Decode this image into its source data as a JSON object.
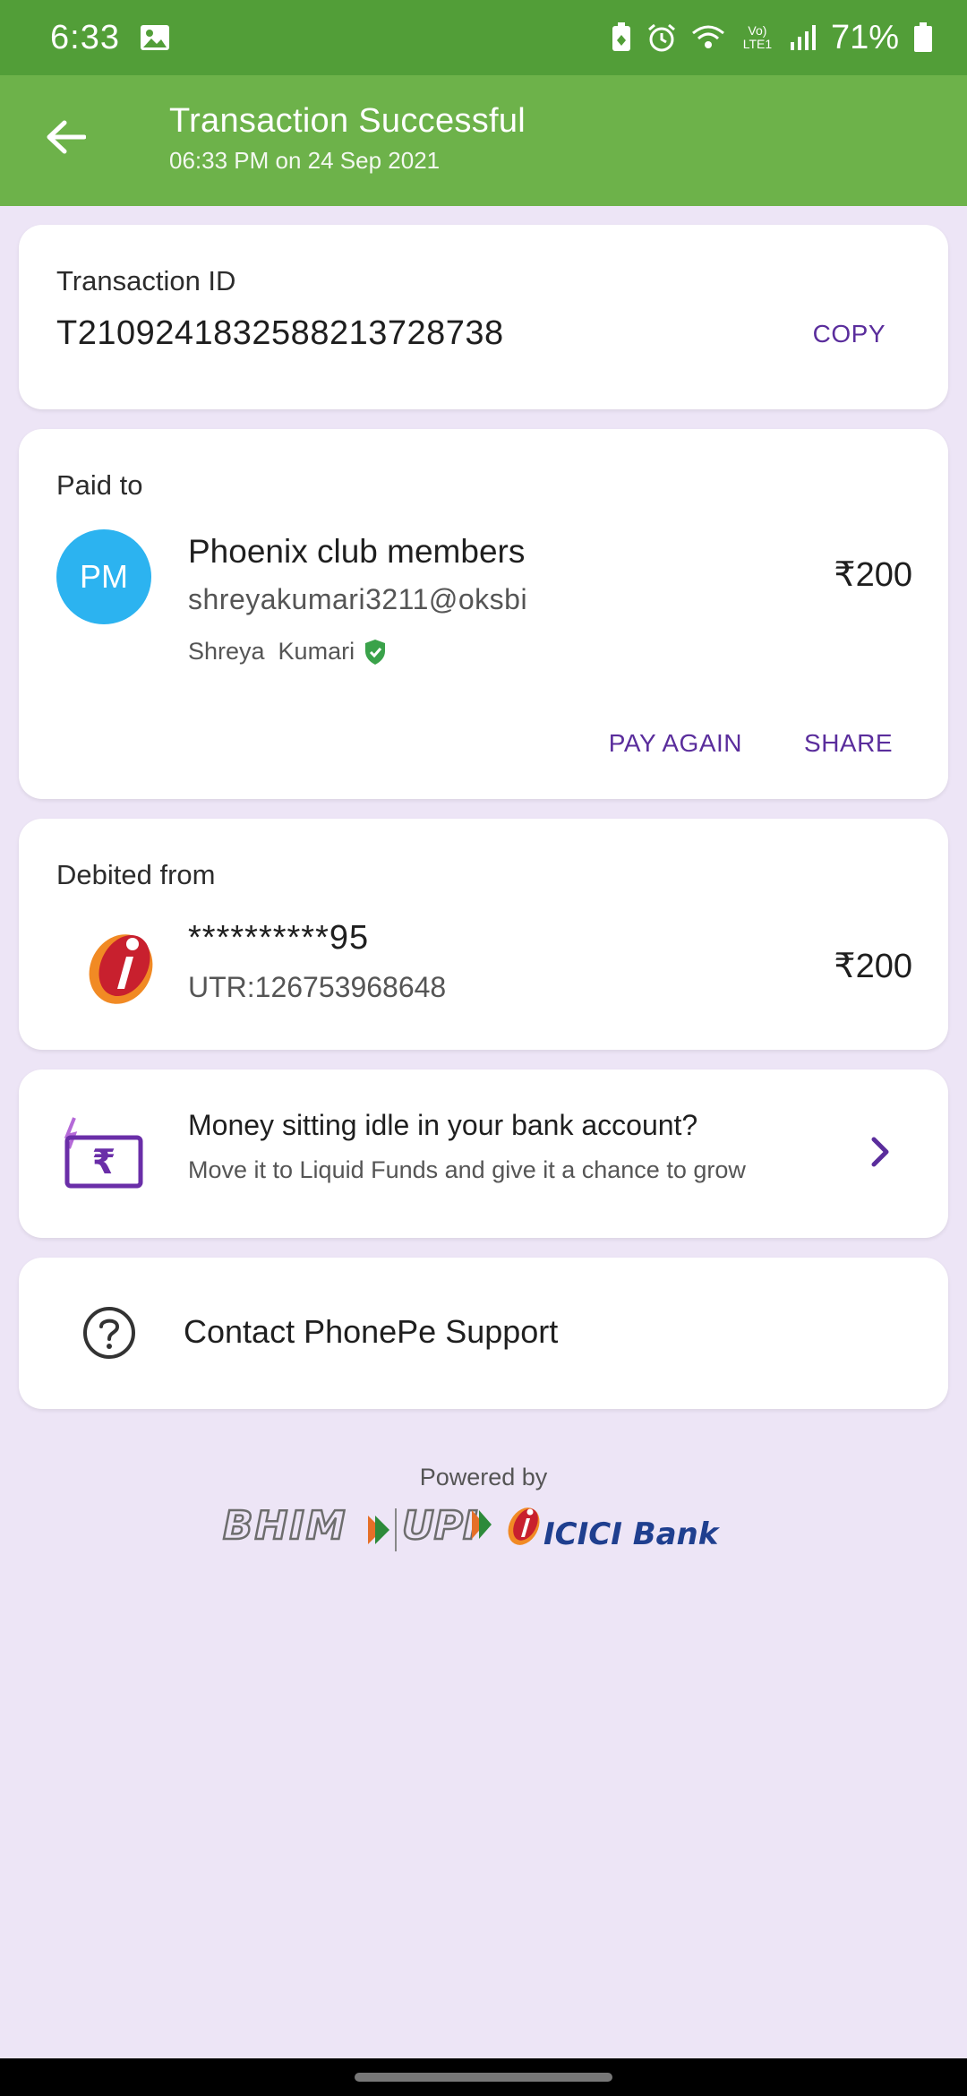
{
  "status_bar": {
    "time": "6:33",
    "battery_pct": "71%",
    "network_label": "Vo) LTE1",
    "icons": [
      "gallery-icon",
      "battery-saver-icon",
      "alarm-icon",
      "wifi-icon",
      "volte-icon",
      "signal-icon",
      "battery-icon"
    ]
  },
  "header": {
    "title": "Transaction Successful",
    "subtitle": "06:33 PM on 24 Sep 2021",
    "back_icon": "arrow-left-icon",
    "color": "#6db24a"
  },
  "transaction": {
    "label": "Transaction ID",
    "id": "T2109241832588213728738",
    "copy_label": "COPY"
  },
  "paid_to": {
    "label": "Paid to",
    "avatar_initials": "PM",
    "avatar_color": "#2cb3f0",
    "name": "Phoenix club members",
    "upi": "shreyakumari3211@oksbi",
    "verified_name": "Shreya  Kumari",
    "amount": "₹200",
    "pay_again_label": "PAY AGAIN",
    "share_label": "SHARE"
  },
  "debited_from": {
    "label": "Debited from",
    "bank_icon": "icici-logo-icon",
    "account": "**********95",
    "utr": "UTR:126753968648",
    "amount": "₹200"
  },
  "promo": {
    "title": "Money sitting idle in your bank account?",
    "subtitle": "Move it to Liquid Funds and give it a chance to grow",
    "icon": "rupee-card-icon"
  },
  "support": {
    "label": "Contact PhonePe Support",
    "icon": "help-circle-icon"
  },
  "footer": {
    "powered_by": "Powered by",
    "brands": [
      "BHIM",
      "UPI",
      "ICICI Bank"
    ]
  },
  "colors": {
    "accent": "#5a2d9c",
    "status_bar": "#529e38",
    "background": "#ede5f6"
  }
}
